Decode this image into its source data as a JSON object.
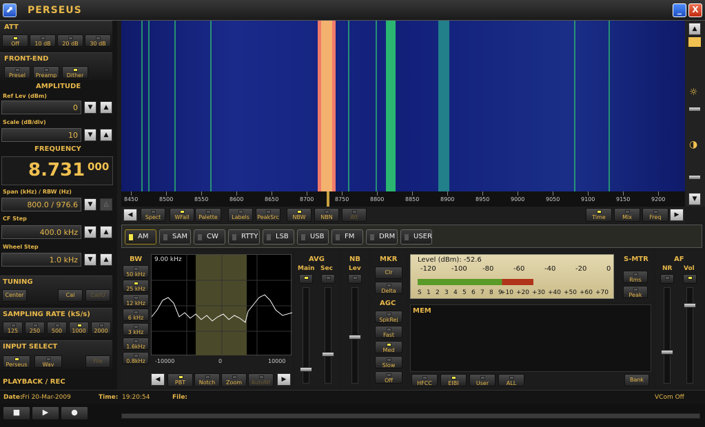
{
  "window": {
    "title": "PERSEUS",
    "minimize_label": "_",
    "close_label": "X"
  },
  "att": {
    "title": "ATT",
    "buttons": [
      {
        "label": "Off",
        "on": true
      },
      {
        "label": "10 dB",
        "on": false
      },
      {
        "label": "20 dB",
        "on": false
      },
      {
        "label": "30 dB",
        "on": false
      }
    ]
  },
  "frontend": {
    "title": "FRONT-END",
    "buttons": [
      {
        "label": "Presel",
        "on": false
      },
      {
        "label": "Preamp",
        "on": false
      },
      {
        "label": "Dither",
        "on": true
      }
    ]
  },
  "amplitude": {
    "title": "AMPLITUDE",
    "ref_label": "Ref Lev (dBm)",
    "ref_value": "0",
    "scale_label": "Scale (dB/div)",
    "scale_value": "10"
  },
  "frequency": {
    "title": "FREQUENCY",
    "main": "8.731",
    "fine": "000",
    "span_label": "Span (kHz) / RBW (Hz)",
    "span_value": "800.0 / 976.6",
    "cf_label": "CF Step",
    "cf_value": "400.0 kHz",
    "wheel_label": "Wheel Step",
    "wheel_value": "1.0 kHz"
  },
  "tuning": {
    "title": "TUNING",
    "center": "Center",
    "cal": "Cal",
    "cal2": "Cal/U"
  },
  "sampling": {
    "title": "SAMPLING RATE (kS/s)",
    "rates": [
      {
        "label": "125",
        "on": false
      },
      {
        "label": "250",
        "on": false
      },
      {
        "label": "500",
        "on": false
      },
      {
        "label": "1000",
        "on": true
      },
      {
        "label": "2000",
        "on": false
      }
    ]
  },
  "input": {
    "title": "INPUT SELECT",
    "buttons": [
      {
        "label": "Perseus",
        "on": true
      },
      {
        "label": "Wav",
        "on": false
      }
    ],
    "file": "File"
  },
  "playback": {
    "title": "PLAYBACK / REC"
  },
  "scale": {
    "ticks": [
      "8450",
      "8500",
      "8550",
      "8600",
      "8650",
      "8700",
      "8750",
      "8800",
      "8850",
      "8900",
      "8950",
      "9000",
      "9050",
      "9100",
      "9150",
      "9200"
    ]
  },
  "toolbar": {
    "left": [
      {
        "label": "Spect",
        "on": false
      },
      {
        "label": "WFall",
        "on": true
      },
      {
        "label": "Palette",
        "on": false
      },
      {
        "label": "Labels",
        "on": false
      },
      {
        "label": "PeakSrc",
        "on": false
      },
      {
        "label": "NBW",
        "on": true
      },
      {
        "label": "NBN",
        "on": false
      },
      {
        "label": "Att",
        "on": false
      }
    ],
    "right": [
      {
        "label": "Time",
        "on": true
      },
      {
        "label": "Mix",
        "on": false
      },
      {
        "label": "Freq",
        "on": false
      }
    ]
  },
  "modes": [
    {
      "label": "AM",
      "on": true
    },
    {
      "label": "SAM",
      "on": false
    },
    {
      "label": "CW",
      "on": false
    },
    {
      "label": "RTTY",
      "on": false
    },
    {
      "label": "LSB",
      "on": false
    },
    {
      "label": "USB",
      "on": false
    },
    {
      "label": "FM",
      "on": false
    },
    {
      "label": "DRM",
      "on": false
    },
    {
      "label": "USER",
      "on": false
    }
  ],
  "bw": {
    "title": "BW",
    "buttons": [
      {
        "label": "50 kHz",
        "on": false
      },
      {
        "label": "25 kHz",
        "on": true
      },
      {
        "label": "12 kHz",
        "on": false
      },
      {
        "label": "6 kHz",
        "on": false
      },
      {
        "label": "3 kHz",
        "on": false
      },
      {
        "label": "1.6kHz",
        "on": false
      },
      {
        "label": "0.8kHz",
        "on": false
      }
    ],
    "value": "9.00 kHz",
    "axis": [
      "-10000",
      "0",
      "10000"
    ],
    "bottom": [
      {
        "label": "PBT",
        "on": true
      },
      {
        "label": "Notch",
        "on": false
      },
      {
        "label": "Zoom",
        "on": false
      },
      {
        "label": "AutoNt",
        "on": false
      }
    ]
  },
  "avg": {
    "title": "AVG",
    "main": "Main",
    "sec": "Sec"
  },
  "nb": {
    "title": "NB",
    "lev": "Lev"
  },
  "mkr": {
    "title": "MKR",
    "clr": "Clr",
    "delta": "Delta"
  },
  "agc": {
    "title": "AGC",
    "buttons": [
      {
        "label": "SpkRej",
        "on": false
      },
      {
        "label": "Fast",
        "on": false
      },
      {
        "label": "Med",
        "on": true
      },
      {
        "label": "Slow",
        "on": false
      },
      {
        "label": "Off",
        "on": false
      }
    ]
  },
  "meter": {
    "level_label": "Level (dBm): -52.6",
    "top_scale": [
      "-120",
      "-100",
      "-80",
      "-60",
      "-40",
      "-20",
      "0"
    ],
    "bottom_scale": [
      "S",
      "1",
      "2",
      "3",
      "4",
      "5",
      "6",
      "7",
      "8",
      "9",
      "+10",
      "+20",
      "+30",
      "+40",
      "+50",
      "+60",
      "+70"
    ],
    "level_fraction": 0.58
  },
  "smtr": {
    "title": "S-MTR",
    "rms": "Rms",
    "peak": "Peak"
  },
  "af": {
    "title": "AF",
    "nr": "NR",
    "vol": "Vol"
  },
  "mem": {
    "title": "MEM",
    "buttons": [
      {
        "label": "HFCC",
        "on": false
      },
      {
        "label": "EIBI",
        "on": true
      },
      {
        "label": "User",
        "on": false
      },
      {
        "label": "ALL",
        "on": false
      }
    ],
    "bank": "Bank"
  },
  "status": {
    "date_label": "Date:",
    "date": "Fri 20-Mar-2009",
    "time_label": "Time:",
    "time": "19:20:54",
    "file_label": "File:",
    "vcom": "VCom Off"
  },
  "colors": {
    "accent": "#e8b84a",
    "led_on": "#f5e84a"
  }
}
